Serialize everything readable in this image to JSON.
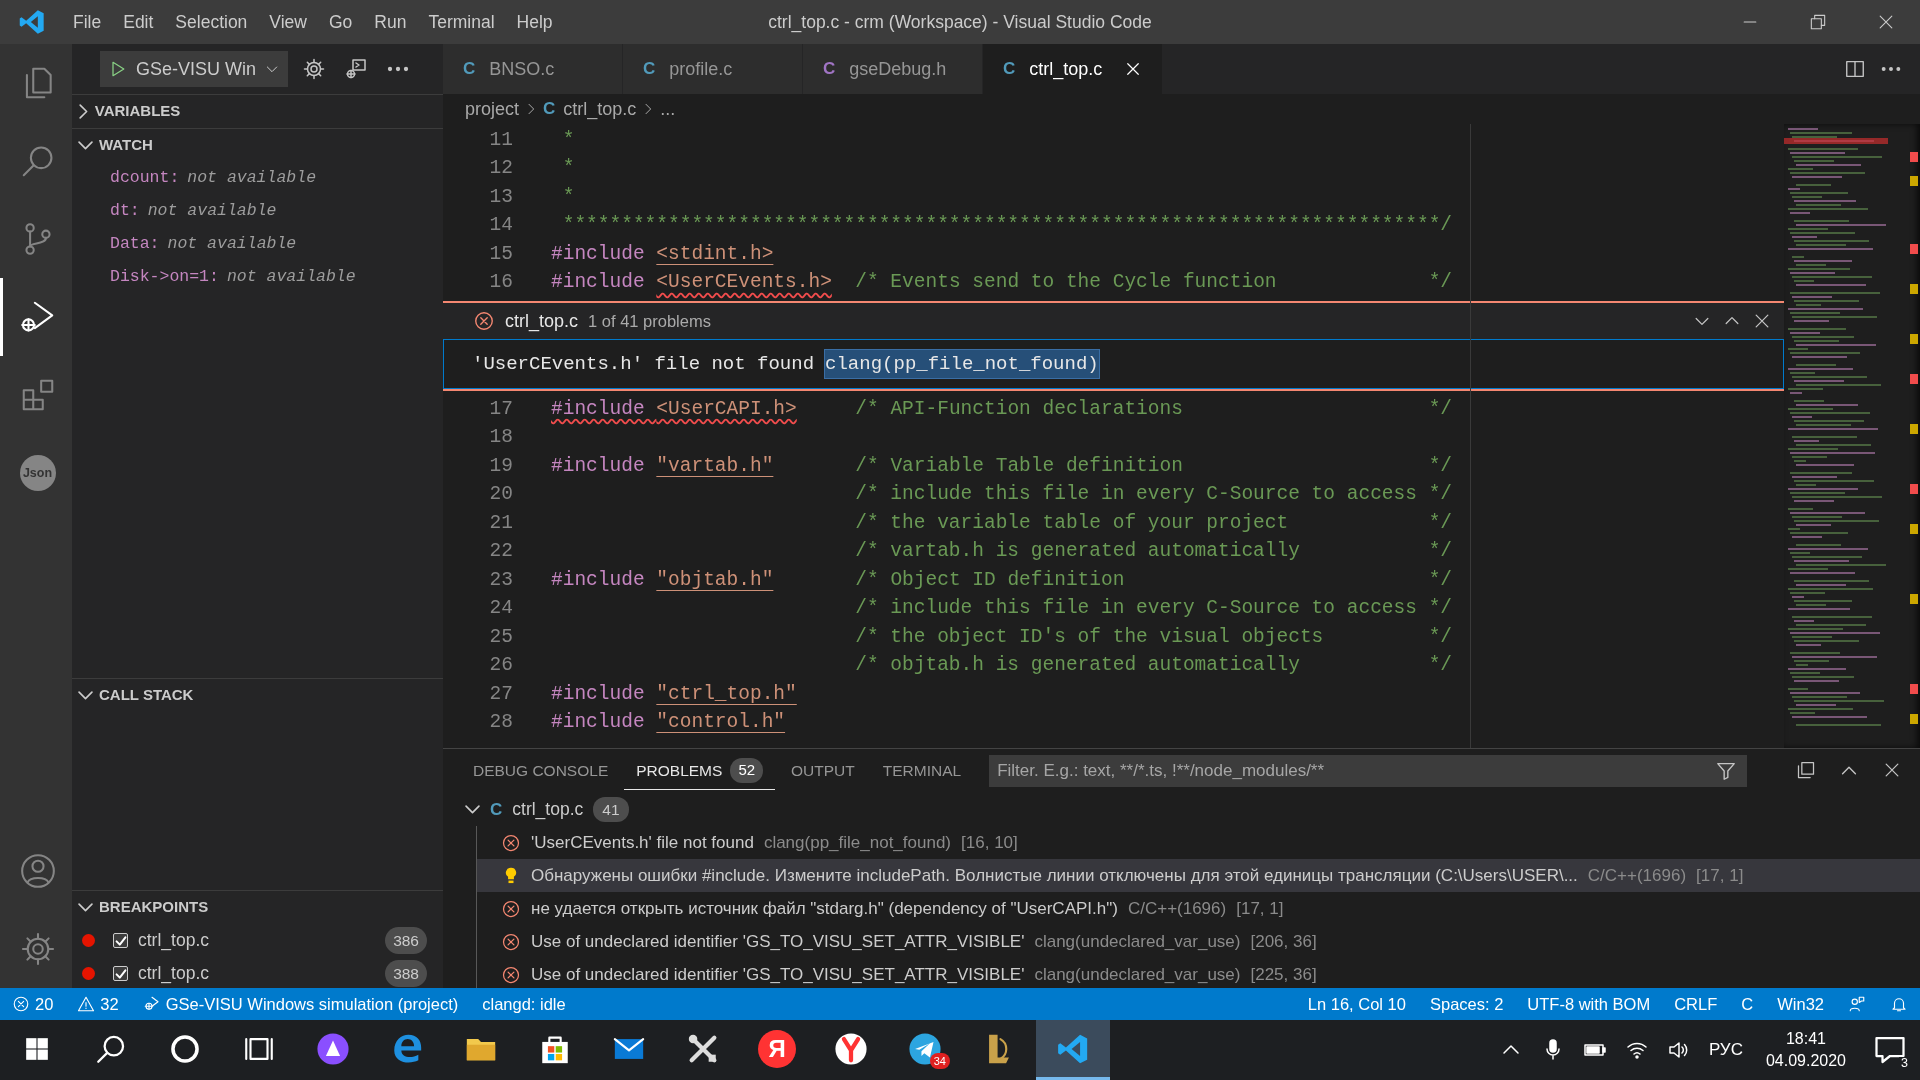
{
  "window": {
    "title": "ctrl_top.c - crm (Workspace) - Visual Studio Code"
  },
  "menu": [
    "File",
    "Edit",
    "Selection",
    "View",
    "Go",
    "Run",
    "Terminal",
    "Help"
  ],
  "activity_bar": {
    "top": [
      {
        "kind": "explorer",
        "selected": false
      },
      {
        "kind": "search",
        "selected": false
      },
      {
        "kind": "source-control",
        "selected": false
      },
      {
        "kind": "run",
        "selected": true
      },
      {
        "kind": "extensions",
        "selected": false
      },
      {
        "kind": "json",
        "label": "Json",
        "selected": false
      }
    ],
    "bottom": [
      {
        "kind": "account",
        "selected": false
      },
      {
        "kind": "settings",
        "selected": false
      }
    ]
  },
  "sidebar": {
    "launch_config": "GSe-VISU Win",
    "sections": [
      {
        "kind": "variables",
        "title": "VARIABLES",
        "expanded": false
      },
      {
        "kind": "watch",
        "title": "WATCH",
        "expanded": true,
        "items": [
          {
            "name": "dcount:",
            "value": "not available"
          },
          {
            "name": "dt:",
            "value": "not available"
          },
          {
            "name": "Data:",
            "value": "not available"
          },
          {
            "name": "Disk->on=1:",
            "value": "not available"
          }
        ]
      },
      {
        "kind": "call-stack",
        "title": "CALL STACK",
        "expanded": true
      },
      {
        "kind": "breakpoints",
        "title": "BREAKPOINTS",
        "expanded": true,
        "items": [
          {
            "file": "ctrl_top.c",
            "line": "386",
            "checked": true
          },
          {
            "file": "ctrl_top.c",
            "line": "388",
            "checked": true
          }
        ]
      }
    ]
  },
  "editor": {
    "tabs": [
      {
        "kind": "source",
        "icon": "C",
        "label": "BNSO.c",
        "selected": false
      },
      {
        "kind": "source",
        "icon": "C",
        "label": "profile.c",
        "selected": false
      },
      {
        "kind": "header",
        "icon": "C",
        "label": "gseDebug.h",
        "selected": false
      },
      {
        "kind": "source",
        "icon": "C",
        "label": "ctrl_top.c",
        "selected": true
      }
    ],
    "breadcrumb": [
      {
        "kind": "folder",
        "label": "project"
      },
      {
        "kind": "file",
        "icon": "C",
        "label": "ctrl_top.c"
      },
      {
        "kind": "more",
        "label": "..."
      }
    ],
    "lines": [
      {
        "kind": "code",
        "number": "11",
        "segments": [
          {
            "kind": "comment",
            "text": " *"
          }
        ]
      },
      {
        "kind": "code",
        "number": "12",
        "segments": [
          {
            "kind": "comment",
            "text": " *"
          }
        ]
      },
      {
        "kind": "code",
        "number": "13",
        "segments": [
          {
            "kind": "comment",
            "text": " *"
          }
        ]
      },
      {
        "kind": "code",
        "number": "14",
        "segments": [
          {
            "kind": "comment",
            "text": " ***************************************************************************/"
          }
        ]
      },
      {
        "kind": "code",
        "number": "15",
        "segments": [
          {
            "kind": "keyword",
            "text": "#include "
          },
          {
            "kind": "string",
            "text": "<stdint.h>",
            "linked": true
          }
        ]
      },
      {
        "kind": "code",
        "number": "16",
        "segments": [
          {
            "kind": "keyword",
            "text": "#include "
          },
          {
            "kind": "string",
            "text": "<UserCEvents.h>",
            "squiggle": true
          },
          {
            "kind": "comment",
            "text": "  /* Events send to the Cycle function             */"
          }
        ]
      },
      {
        "kind": "peek",
        "file": "ctrl_top.c",
        "summary": "1 of 41 problems",
        "message": "'UserCEvents.h' file not found",
        "code": "clang(pp_file_not_found)"
      },
      {
        "kind": "code",
        "number": "17",
        "segments": [
          {
            "kind": "keyword",
            "text": "#include ",
            "squiggle": true
          },
          {
            "kind": "string",
            "text": "<UserCAPI.h>",
            "squiggle": true
          },
          {
            "kind": "comment",
            "text": "     /* API-Function declarations                     */"
          }
        ]
      },
      {
        "kind": "code",
        "number": "18"
      },
      {
        "kind": "code",
        "number": "19",
        "segments": [
          {
            "kind": "keyword",
            "text": "#include "
          },
          {
            "kind": "string",
            "text": "\"vartab.h\"",
            "linked": true
          },
          {
            "kind": "comment",
            "text": "       /* Variable Table definition                     */"
          }
        ]
      },
      {
        "kind": "code",
        "number": "20",
        "segments": [
          {
            "kind": "comment",
            "text": "                          /* include this file in every C-Source to access */"
          }
        ]
      },
      {
        "kind": "code",
        "number": "21",
        "segments": [
          {
            "kind": "comment",
            "text": "                          /* the variable table of your project            */"
          }
        ]
      },
      {
        "kind": "code",
        "number": "22",
        "segments": [
          {
            "kind": "comment",
            "text": "                          /* vartab.h is generated automatically           */"
          }
        ]
      },
      {
        "kind": "code",
        "number": "23",
        "segments": [
          {
            "kind": "keyword",
            "text": "#include "
          },
          {
            "kind": "string",
            "text": "\"objtab.h\"",
            "linked": true
          },
          {
            "kind": "comment",
            "text": "       /* Object ID definition                          */"
          }
        ]
      },
      {
        "kind": "code",
        "number": "24",
        "segments": [
          {
            "kind": "comment",
            "text": "                          /* include this file in every C-Source to access */"
          }
        ]
      },
      {
        "kind": "code",
        "number": "25",
        "segments": [
          {
            "kind": "comment",
            "text": "                          /* the object ID's of the visual objects         */"
          }
        ]
      },
      {
        "kind": "code",
        "number": "26",
        "segments": [
          {
            "kind": "comment",
            "text": "                          /* objtab.h is generated automatically           */"
          }
        ]
      },
      {
        "kind": "code",
        "number": "27",
        "segments": [
          {
            "kind": "keyword",
            "text": "#include "
          },
          {
            "kind": "string",
            "text": "\"ctrl_top.h\"",
            "linked": true
          }
        ]
      },
      {
        "kind": "code",
        "number": "28",
        "segments": [
          {
            "kind": "keyword",
            "text": "#include "
          },
          {
            "kind": "string",
            "text": "\"control.h\"",
            "linked": true
          }
        ]
      }
    ]
  },
  "panel": {
    "tabs": [
      {
        "label": "DEBUG CONSOLE",
        "selected": false
      },
      {
        "label": "PROBLEMS",
        "badge": "52",
        "selected": true
      },
      {
        "label": "OUTPUT",
        "selected": false
      },
      {
        "label": "TERMINAL",
        "selected": false
      }
    ],
    "filter": {
      "placeholder": "Filter. E.g.: text, **/*.ts, !**/node_modules/**"
    },
    "problems": [
      {
        "icon": "C",
        "file": "ctrl_top.c",
        "count": "41",
        "expanded": true,
        "children": [
          {
            "kind": "error",
            "message": "'UserCEvents.h' file not found",
            "source": "clang(pp_file_not_found)",
            "position": "[16, 10]",
            "selected": false
          },
          {
            "kind": "hint",
            "message": "Обнаружены ошибки #include. Измените includePath. Волнистые линии отключены для этой единицы трансляции (C:\\Users\\USER\\...",
            "source": "C/C++(1696)",
            "position": "[17, 1]",
            "selected": true
          },
          {
            "kind": "error",
            "message": "не удается открыть источник файл \"stdarg.h\" (dependency of \"UserCAPI.h\")",
            "source": "C/C++(1696)",
            "position": "[17, 1]",
            "selected": false
          },
          {
            "kind": "error",
            "message": "Use of undeclared identifier 'GS_TO_VISU_SET_ATTR_VISIBLE'",
            "source": "clang(undeclared_var_use)",
            "position": "[206, 36]",
            "selected": false
          },
          {
            "kind": "error",
            "message": "Use of undeclared identifier 'GS_TO_VISU_SET_ATTR_VISIBLE'",
            "source": "clang(undeclared_var_use)",
            "position": "[225, 36]",
            "selected": false
          }
        ]
      }
    ]
  },
  "status_bar": {
    "left": [
      {
        "kind": "errors",
        "text": "20"
      },
      {
        "kind": "warnings",
        "text": "32"
      },
      {
        "kind": "debug",
        "text": "GSe-VISU Windows simulation (project)"
      },
      {
        "kind": "plain",
        "text": "clangd: idle"
      }
    ],
    "right": [
      {
        "kind": "plain",
        "text": "Ln 16, Col 10"
      },
      {
        "kind": "plain",
        "text": "Spaces: 2"
      },
      {
        "kind": "plain",
        "text": "UTF-8 with BOM"
      },
      {
        "kind": "plain",
        "text": "CRLF"
      },
      {
        "kind": "plain",
        "text": "C"
      },
      {
        "kind": "plain",
        "text": "Win32"
      },
      {
        "kind": "feedback"
      },
      {
        "kind": "bell"
      }
    ]
  },
  "taskbar": {
    "apps": [
      {
        "kind": "start",
        "active": false
      },
      {
        "kind": "search",
        "active": false
      },
      {
        "kind": "cortana",
        "active": false
      },
      {
        "kind": "task-view",
        "active": false
      },
      {
        "kind": "alice",
        "active": false
      },
      {
        "kind": "edge",
        "active": false
      },
      {
        "kind": "folder",
        "active": false
      },
      {
        "kind": "store",
        "active": false
      },
      {
        "kind": "mail",
        "active": false
      },
      {
        "kind": "tools",
        "active": false
      },
      {
        "kind": "yandex",
        "label": "Я",
        "active": false
      },
      {
        "kind": "yandex-browser",
        "active": false
      },
      {
        "kind": "telegram",
        "badge": "34",
        "active": false
      },
      {
        "kind": "league",
        "active": false
      },
      {
        "kind": "vscode",
        "active": true
      }
    ],
    "tray": [
      {
        "kind": "chevron"
      },
      {
        "kind": "mic"
      },
      {
        "kind": "battery"
      },
      {
        "kind": "wifi"
      },
      {
        "kind": "volume"
      },
      {
        "kind": "language",
        "text": "РУС"
      }
    ],
    "clock": {
      "time": "18:41",
      "date": "04.09.2020"
    },
    "notifications": "3"
  }
}
